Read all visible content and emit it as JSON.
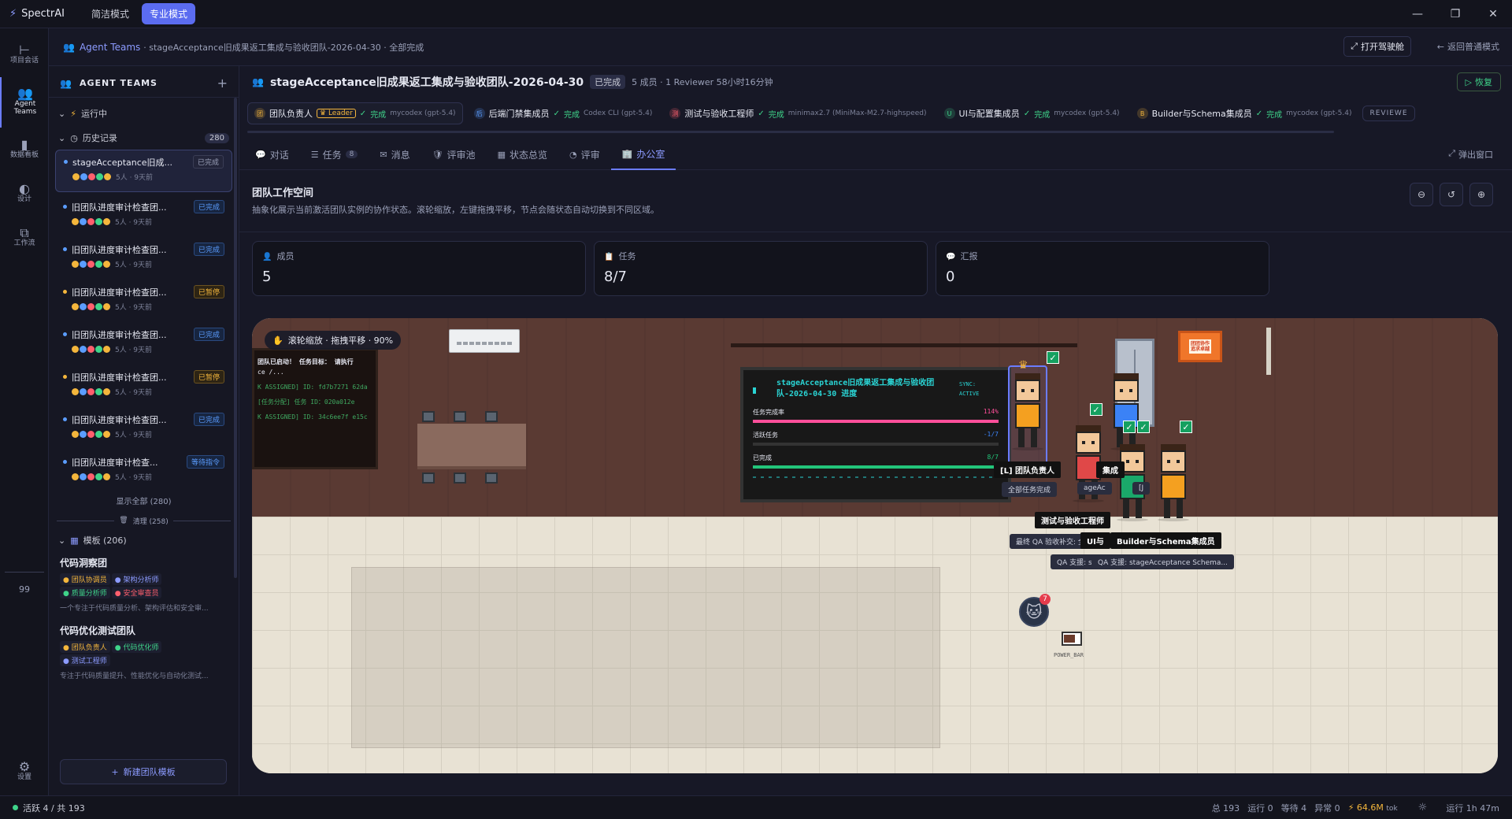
{
  "app": {
    "name": "SpectrAI",
    "mode_simple": "简洁模式",
    "mode_pro": "专业模式"
  },
  "rail": {
    "items": [
      {
        "label": "项目会话"
      },
      {
        "label": "Agent Teams"
      },
      {
        "label": "数据看板"
      },
      {
        "label": "设计"
      },
      {
        "label": "工作流"
      }
    ],
    "count": "99",
    "settings": "设置"
  },
  "topbar": {
    "crumb": "Agent Teams",
    "subtitle": "· stageAcceptance旧成果返工集成与验收团队-2026-04-30 · 全部完成",
    "open_cockpit": "打开驾驶舱",
    "back_normal": "返回普通模式"
  },
  "sidebar": {
    "header": "AGENT TEAMS",
    "running": "运行中",
    "history": "历史记录",
    "history_count": "280",
    "teams": [
      {
        "name": "stageAcceptance旧成...",
        "status": "已完成",
        "meta": "5人 · 9天前",
        "cls": "s-done"
      },
      {
        "name": "旧团队进度审计检查团...",
        "status": "已完成",
        "meta": "5人 · 9天前",
        "cls": "s-blue"
      },
      {
        "name": "旧团队进度审计检查团...",
        "status": "已完成",
        "meta": "5人 · 9天前",
        "cls": "s-blue"
      },
      {
        "name": "旧团队进度审计检查团...",
        "status": "已暂停",
        "meta": "5人 · 9天前",
        "cls": "s-amber"
      },
      {
        "name": "旧团队进度审计检查团...",
        "status": "已完成",
        "meta": "5人 · 9天前",
        "cls": "s-blue"
      },
      {
        "name": "旧团队进度审计检查团...",
        "status": "已暂停",
        "meta": "5人 · 9天前",
        "cls": "s-amber"
      },
      {
        "name": "旧团队进度审计检查团...",
        "status": "已完成",
        "meta": "5人 · 9天前",
        "cls": "s-blue"
      },
      {
        "name": "旧团队进度审计检查...",
        "status": "等待指令",
        "meta": "5人 · 9天前",
        "cls": "s-blue"
      }
    ],
    "show_all": "显示全部 (280)",
    "cleanup": "清理 (258)",
    "templates_label": "模板 (206)",
    "templates": [
      {
        "name": "代码洞察团",
        "tags": [
          {
            "t": "团队协调员",
            "c": "#f4b63c"
          },
          {
            "t": "架构分析师",
            "c": "#8c9bff"
          },
          {
            "t": "质量分析师",
            "c": "#3fd48a"
          },
          {
            "t": "安全审查员",
            "c": "#ff5f6d"
          }
        ],
        "desc": "一个专注于代码质量分析、架构评估和安全审..."
      },
      {
        "name": "代码优化测试团队",
        "tags": [
          {
            "t": "团队负责人",
            "c": "#f4b63c"
          },
          {
            "t": "代码优化师",
            "c": "#3fd48a"
          },
          {
            "t": "测试工程师",
            "c": "#8c9bff"
          }
        ],
        "desc": "专注于代码质量提升、性能优化与自动化测试..."
      }
    ],
    "new_template": "新建团队模板"
  },
  "team": {
    "title": "stageAcceptance旧成果返工集成与验收团队-2026-04-30",
    "status": "已完成",
    "meta": "5 成员 · 1 Reviewer 58小时16分钟",
    "restore": "恢复"
  },
  "members": [
    {
      "name": "团队负责人",
      "badge": "Leader",
      "status": "完成",
      "model": "mycodex (gpt-5.4)",
      "color": "#f4b63c",
      "letter": "团"
    },
    {
      "name": "后端门禁集成员",
      "badge": "",
      "status": "完成",
      "model": "Codex CLI (gpt-5.4)",
      "color": "#5b9dff",
      "letter": "后"
    },
    {
      "name": "测试与验收工程师",
      "badge": "",
      "status": "完成",
      "model": "minimax2.7 (MiniMax-M2.7-highspeed)",
      "color": "#ff5f6d",
      "letter": "测"
    },
    {
      "name": "UI与配置集成员",
      "badge": "",
      "status": "完成",
      "model": "mycodex (gpt-5.4)",
      "color": "#3fd48a",
      "letter": "U"
    },
    {
      "name": "Builder与Schema集成员",
      "badge": "",
      "status": "完成",
      "model": "mycodex (gpt-5.4)",
      "color": "#f4b63c",
      "letter": "B"
    }
  ],
  "members_reviewer": "REVIEWE",
  "tabs": [
    {
      "label": "对话",
      "icon": "💬"
    },
    {
      "label": "任务",
      "icon": "☰",
      "count": "8"
    },
    {
      "label": "消息",
      "icon": "✉"
    },
    {
      "label": "评审池",
      "icon": "🛡"
    },
    {
      "label": "状态总览",
      "icon": "▦"
    },
    {
      "label": "评审",
      "icon": "◔"
    },
    {
      "label": "办公室",
      "icon": "🏢"
    }
  ],
  "popout": "弹出窗口",
  "workspace": {
    "title": "团队工作空间",
    "desc": "抽象化展示当前激活团队实例的协作状态。滚轮缩放，左键拖拽平移，节点会随状态自动切换到不同区域。"
  },
  "stats": [
    {
      "label": "成员",
      "value": "5",
      "icon": "user-icon"
    },
    {
      "label": "任务",
      "value": "8/7",
      "icon": "clipboard-icon"
    },
    {
      "label": "汇报",
      "value": "0",
      "icon": "report-icon"
    }
  ],
  "scene": {
    "zoom_hint": "滚轮缩放 · 拖拽平移 · 90%",
    "log_lines": [
      "团队已启动！ 任务目标： 请执行",
      "ce /...",
      "K ASSIGNED] ID: fd7b7271 62da",
      "[任务分配] 任务 ID：020a012e",
      "K ASSIGNED] ID: 34c6ee7f e15c"
    ],
    "board_title": "stageAcceptance旧成果返工集成与验收团队-2026-04-30 进度",
    "board_sync": "SYNC:",
    "board_active": "ACTIVE",
    "progress": [
      {
        "label": "任务完成率",
        "value": "114%",
        "fill": 1.0,
        "color": "#ff4f9a"
      },
      {
        "label": "活跃任务",
        "value": "-1/7",
        "fill": 0.0,
        "color": "#3b82f6"
      },
      {
        "label": "已完成",
        "value": "8/7",
        "fill": 1.0,
        "color": "#22c57a"
      }
    ],
    "poster_text": "团团协作\n追求卓越",
    "nametags": {
      "leader": "[L] 团队负责人",
      "leader_bubble": "全部任务完成",
      "ui": "集成",
      "tester": "测试与验收工程师",
      "tester_bubble": "最终 QA 验收补交: 全",
      "builder_left": "UI与",
      "builder": "Builder与Schema集成员",
      "qa1": "QA 支援: s",
      "qa2": "QA 支援: stageAcceptance Schema..."
    },
    "bubble_mid": "ageAc",
    "bubble_mid2": "[J",
    "cat_badge": "7",
    "powerbar": "POWER_BAR"
  },
  "status": {
    "active": "活跃 4 / 共 193",
    "total": "总 193",
    "running": "运行 0",
    "waiting": "等待 4",
    "error": "异常 0",
    "tokens": "64.6M",
    "tok_unit": "tok",
    "uptime": "运行 1h 47m"
  },
  "colors": {
    "accent": "#6b7cff",
    "ok": "#3fd48a",
    "warn": "#f4b63c"
  }
}
